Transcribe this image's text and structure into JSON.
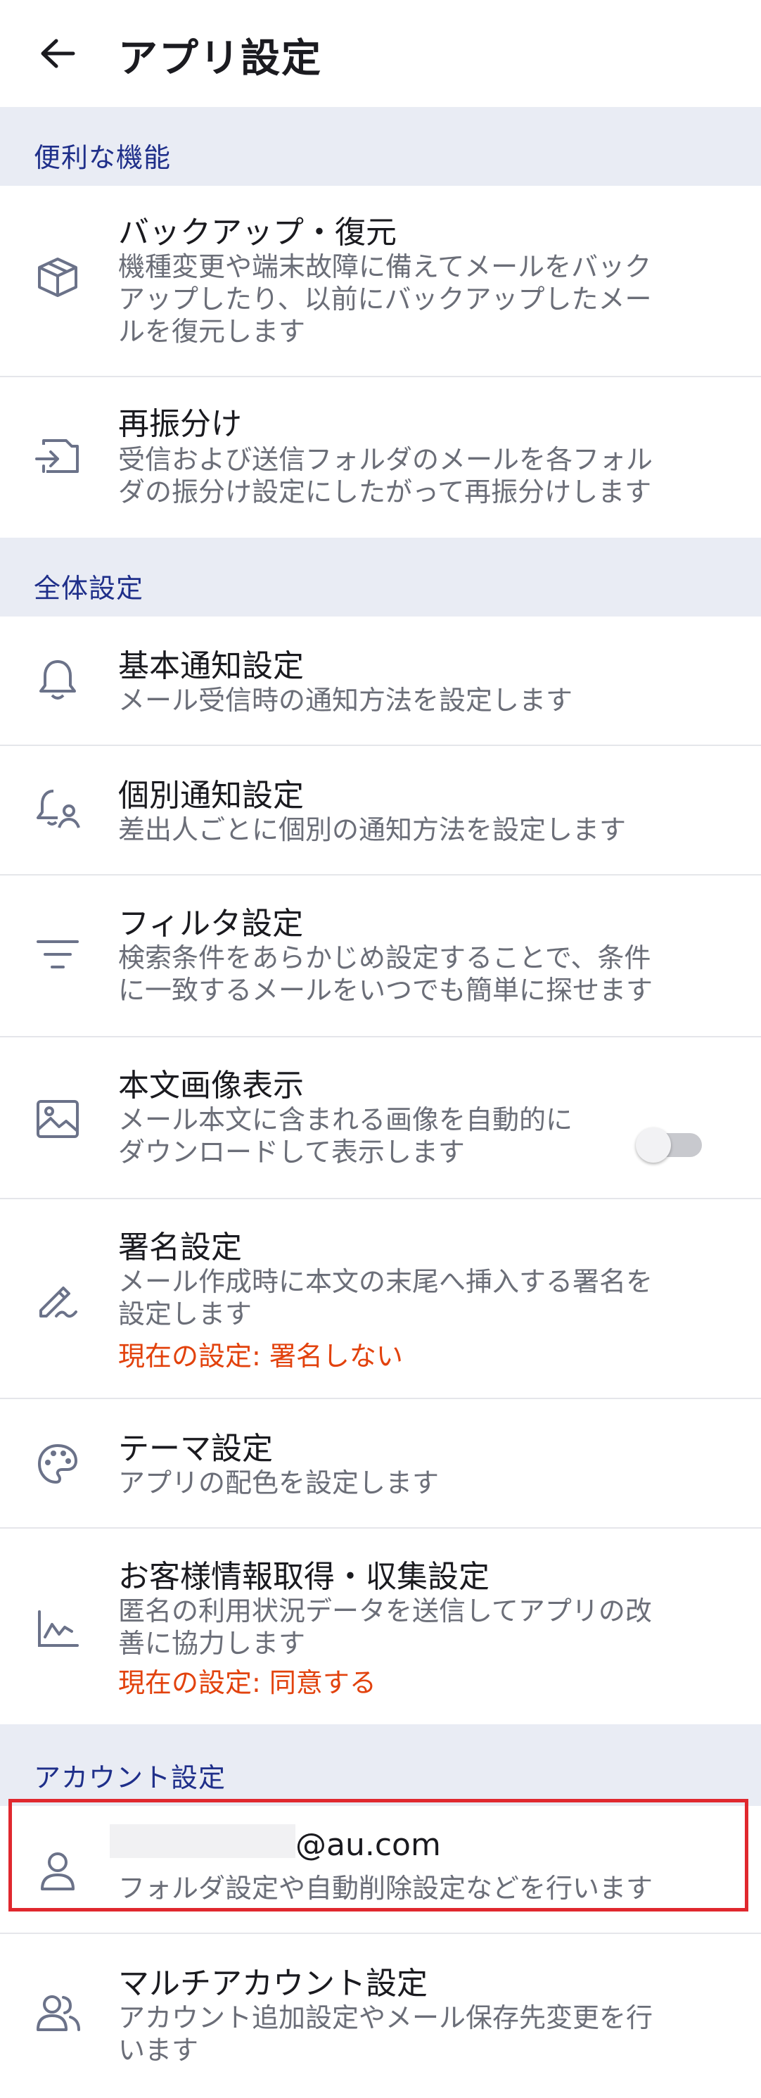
{
  "header": {
    "title": "アプリ設定",
    "back_icon": "arrow-left-icon"
  },
  "sections": {
    "convenience": "便利な機能",
    "general": "全体設定",
    "account": "アカウント設定"
  },
  "items": {
    "backup": {
      "title": "バックアップ・復元",
      "desc": "機種変更や端末故障に備えてメールをバック\nアップしたり、以前にバックアップしたメー\nルを復元します",
      "icon": "box-icon"
    },
    "resort": {
      "title": "再振分け",
      "desc": "受信および送信フォルダのメールを各フォル\nダの振分け設定にしたがって再振分けします",
      "icon": "resort-icon"
    },
    "notify": {
      "title": "基本通知設定",
      "desc": "メール受信時の通知方法を設定します",
      "icon": "bell-icon"
    },
    "individual_notify": {
      "title": "個別通知設定",
      "desc": "差出人ごとに個別の通知方法を設定します",
      "icon": "bell-person-icon"
    },
    "filter": {
      "title": "フィルタ設定",
      "desc": "検索条件をあらかじめ設定することで、条件\nに一致するメールをいつでも簡単に探せます",
      "icon": "filter-icon"
    },
    "image": {
      "title": "本文画像表示",
      "desc": "メール本文に含まれる画像を自動的に\nダウンロードして表示します",
      "icon": "image-icon",
      "toggle_on": false
    },
    "signature": {
      "title": "署名設定",
      "desc": "メール作成時に本文の末尾へ挿入する署名を\n設定します",
      "current": "現在の設定: 署名しない",
      "icon": "pen-icon"
    },
    "theme": {
      "title": "テーマ設定",
      "desc": "アプリの配色を設定します",
      "icon": "palette-icon"
    },
    "data": {
      "title": "お客様情報取得・収集設定",
      "desc": "匿名の利用状況データを送信してアプリの改\n善に協力します",
      "current": "現在の設定: 同意する",
      "icon": "chart-icon"
    },
    "account": {
      "title": "@au.com",
      "desc": "フォルダ設定や自動削除設定などを行います",
      "icon": "person-icon"
    },
    "multi": {
      "title": "マルチアカウント設定",
      "desc": "アカウント追加設定やメール保存先変更を行\nいます",
      "icon": "people-icon"
    }
  },
  "colors": {
    "section_bg": "#e9ecf4",
    "section_text": "#1f2f8a",
    "current_setting": "#e2420d",
    "highlight": "#e0282e"
  }
}
